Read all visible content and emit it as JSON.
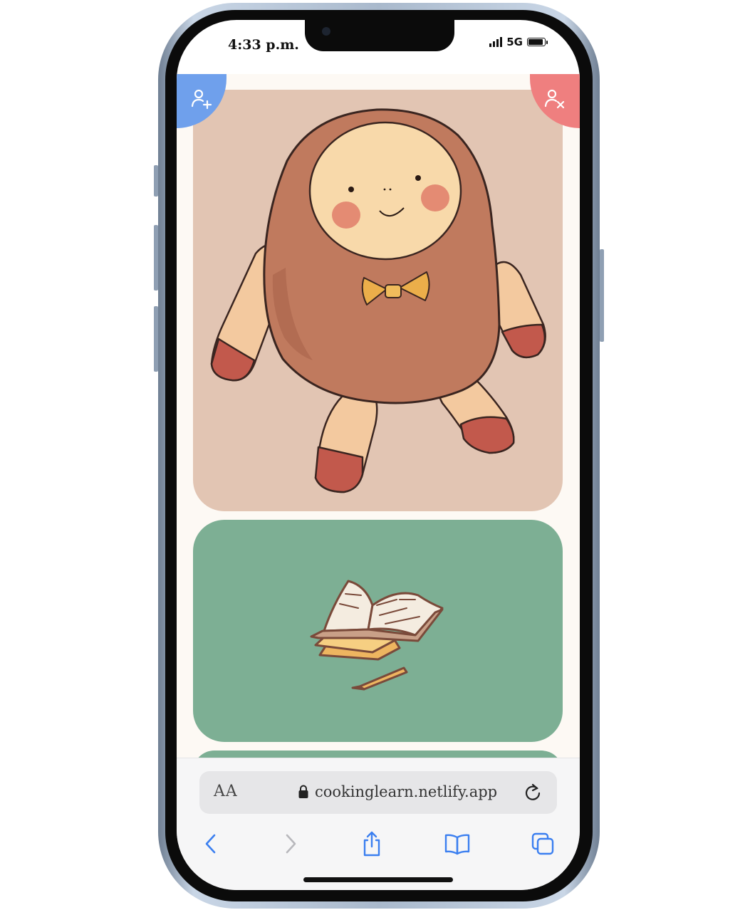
{
  "status_bar": {
    "time": "4:33 p.m.",
    "network": "5G",
    "battery_level": 0.9
  },
  "page": {
    "add_user_button": {
      "icon": "user-plus-icon",
      "color": "#6fa0ec"
    },
    "remove_user_button": {
      "icon": "user-x-icon",
      "color": "#ef7f7f"
    },
    "cards": [
      {
        "illustration": "cute-doll-character",
        "background": "#e2c5b3"
      },
      {
        "illustration": "open-book-and-pencil",
        "background": "#7daf94"
      },
      {
        "illustration": "partial-card",
        "background": "#7daf94"
      }
    ]
  },
  "browser": {
    "text_size_button": "AA",
    "url": "cookinglearn.netlify.app",
    "toolbar": [
      "back-icon",
      "forward-icon",
      "share-icon",
      "bookmarks-icon",
      "tabs-icon"
    ]
  }
}
